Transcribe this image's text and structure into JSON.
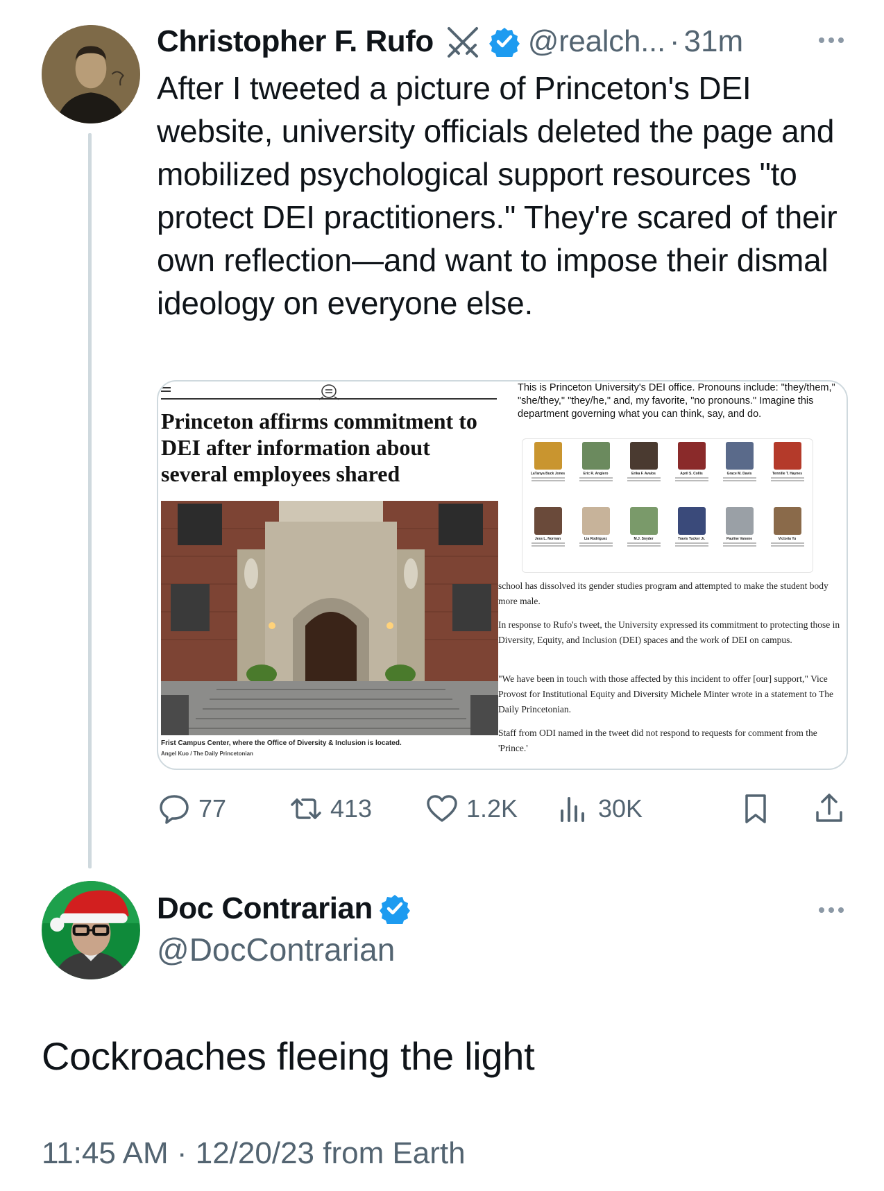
{
  "tweet1": {
    "name": "Christopher F. Rufo",
    "handle": "@realch...",
    "separator": "·",
    "time": "31m",
    "text": "After I tweeted a picture of Princeton's DEI website, university officials deleted the page and mobilized psychological support resources \"to protect DEI practitioners.\" They're scared of their own reflection—and want to impose their dismal ideology on everyone else.",
    "media": {
      "headline": "Princeton affirms commitment to DEI after information about several employees shared",
      "caption": "Frist Campus Center, where the Office of Diversity & Inclusion is located.",
      "credit": "Angel Kuo / The Daily Princetonian",
      "embedded_tweet": "This is Princeton University's DEI office. Pronouns include: \"they/them,\" \"she/they,\" \"they/he,\" and, my favorite, \"no pronouns.\" Imagine this department governing what you can think, say, and do.",
      "staff_names": [
        "LaTanya Buck Jones",
        "Eric R. Anglero",
        "Erika F. Avalos",
        "April S. Collis",
        "Grace M. Davis",
        "Tennille T. Haynes",
        "Jess L. Norman",
        "Lia Rodriguez",
        "M.J. Snyder",
        "Travis Tucker Jr.",
        "Pauline Vanone",
        "Victoria Yu"
      ],
      "paragraphs": [
        "school has dissolved its gender studies program and attempted to make the student body more male.",
        "In response to Rufo's tweet, the University expressed its commitment to protecting those in Diversity, Equity, and Inclusion (DEI) spaces and the work of DEI on campus.",
        "\"We have been in touch with those affected by this incident to offer [our] support,\" Vice Provost for Institutional Equity and Diversity Michele Minter wrote in a statement to The Daily Princetonian.",
        "Staff from ODI named in the tweet did not respond to requests for comment from the 'Prince.'"
      ]
    },
    "actions": {
      "replies": "77",
      "reposts": "413",
      "likes": "1.2K",
      "views": "30K"
    }
  },
  "tweet2": {
    "name": "Doc Contrarian",
    "handle": "@DocContrarian",
    "text": "Cockroaches fleeing the light",
    "meta": "11:45 AM · 12/20/23 from Earth"
  },
  "colors": {
    "verified_blue": "#1d9bf0",
    "secondary_text": "#536471",
    "thread_line": "#cfd9de"
  },
  "icons": [
    "verified-badge-icon",
    "crossed-swords-icon",
    "more-icon",
    "reply-icon",
    "repost-icon",
    "like-icon",
    "views-icon",
    "bookmark-icon",
    "share-icon"
  ]
}
